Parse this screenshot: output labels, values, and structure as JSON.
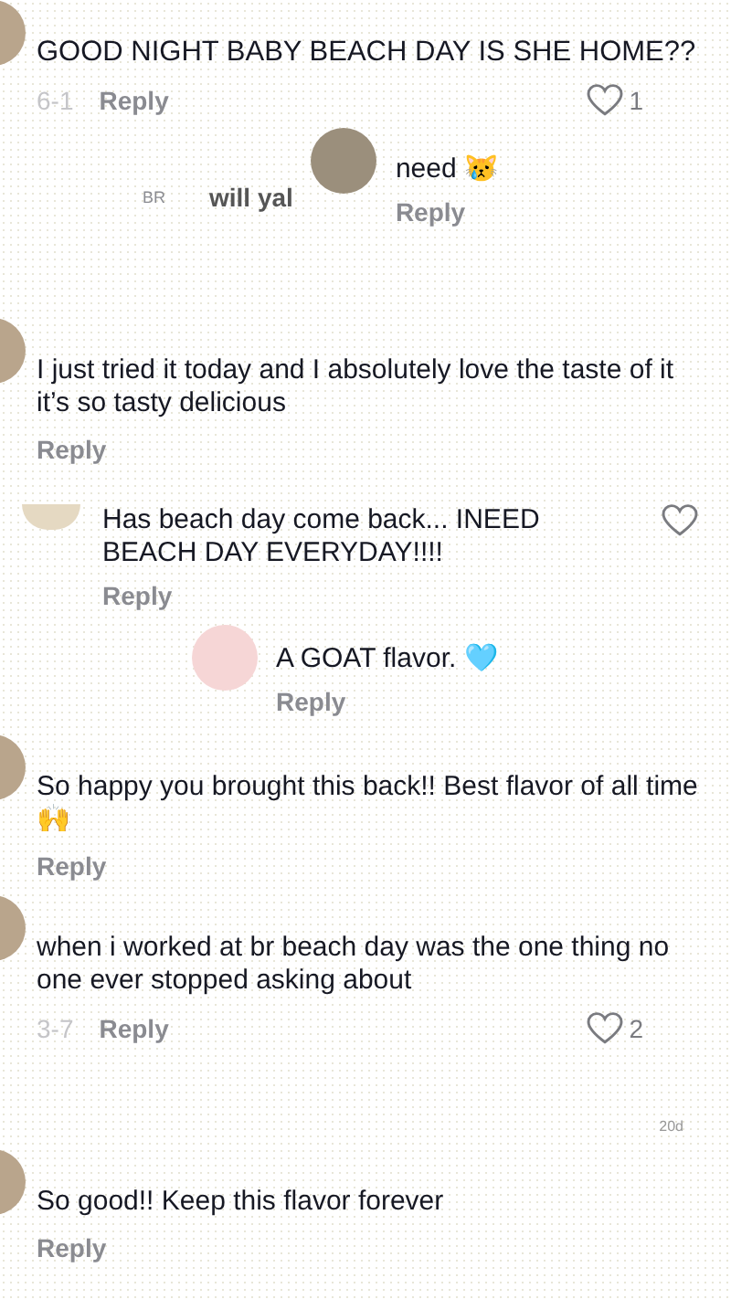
{
  "comments": [
    {
      "text": "GOOD NIGHT BABY BEACH DAY IS SHE HOME??",
      "date": "6-1",
      "reply": "Reply",
      "likes": "1",
      "liked": false,
      "fragments": [
        "BR",
        "will yal"
      ],
      "children": [
        {
          "text": "need 😿",
          "reply": "Reply"
        }
      ]
    },
    {
      "text": "I just tried it today and I absolutely love the taste of it it’s so tasty delicious",
      "reply": "Reply",
      "children": [
        {
          "text": "Has beach day come back... INEED BEACH DAY EVERYDAY!!!!",
          "reply": "Reply",
          "liked": false,
          "children": [
            {
              "text": "A GOAT flavor. 🩵",
              "reply": "Reply"
            }
          ]
        }
      ]
    },
    {
      "text": "So happy you brought this back!! Best flavor of all time 🙌",
      "reply": "Reply"
    },
    {
      "text": "when i worked at br beach day was the one thing no one ever stopped asking about",
      "date": "3-7",
      "reply": "Reply",
      "likes": "2",
      "liked": false,
      "note": "20d"
    },
    {
      "text": "So good!! Keep this flavor forever",
      "reply": "Reply"
    }
  ]
}
